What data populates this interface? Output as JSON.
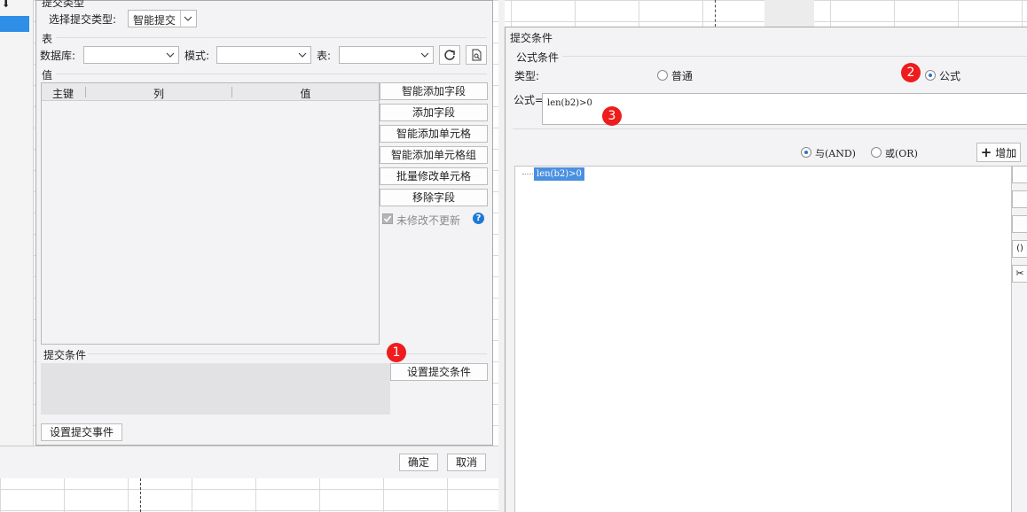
{
  "left_dialog": {
    "header_partial": "提交类型",
    "submit_type_label": "选择提交类型:",
    "submit_type_value": "智能提交",
    "table_section_label": "表",
    "database_label": "数据库:",
    "database_value": "",
    "mode_label": "模式:",
    "mode_value": "",
    "table_label": "表:",
    "table_value": "",
    "refresh_icon": "refresh-icon",
    "preview_icon": "search-doc-icon",
    "value_section_label": "值",
    "columns": [
      "主键",
      "列",
      "值"
    ],
    "buttons": [
      "智能添加字段",
      "添加字段",
      "智能添加单元格",
      "智能添加单元格组",
      "批量修改单元格",
      "移除字段"
    ],
    "checkbox_label": "未修改不更新",
    "checkbox_checked": true,
    "help_icon": "help-icon",
    "condition_section_label": "提交条件",
    "set_condition_button": "设置提交条件",
    "set_event_button": "设置提交事件",
    "ok_button": "确定",
    "cancel_button": "取消"
  },
  "right_dialog": {
    "title": "提交条件",
    "formula_condition_label": "公式条件",
    "type_label": "类型:",
    "type_options": [
      {
        "label": "普通",
        "selected": false
      },
      {
        "label": "公式",
        "selected": true
      }
    ],
    "formula_label": "公式=",
    "formula_value": "len(b2)>0",
    "logic_options": [
      {
        "label": "与(AND)",
        "selected": true
      },
      {
        "label": "或(OR)",
        "selected": false
      }
    ],
    "add_button": "增加",
    "tree_items": [
      "len(b2)>0"
    ],
    "side_button_glyphs": [
      "()",
      "✂"
    ]
  },
  "badges": [
    "1",
    "2",
    "3"
  ],
  "colors": {
    "badge": "#ee1c1c",
    "selection": "#4a90e2",
    "help": "#1e78d6"
  }
}
